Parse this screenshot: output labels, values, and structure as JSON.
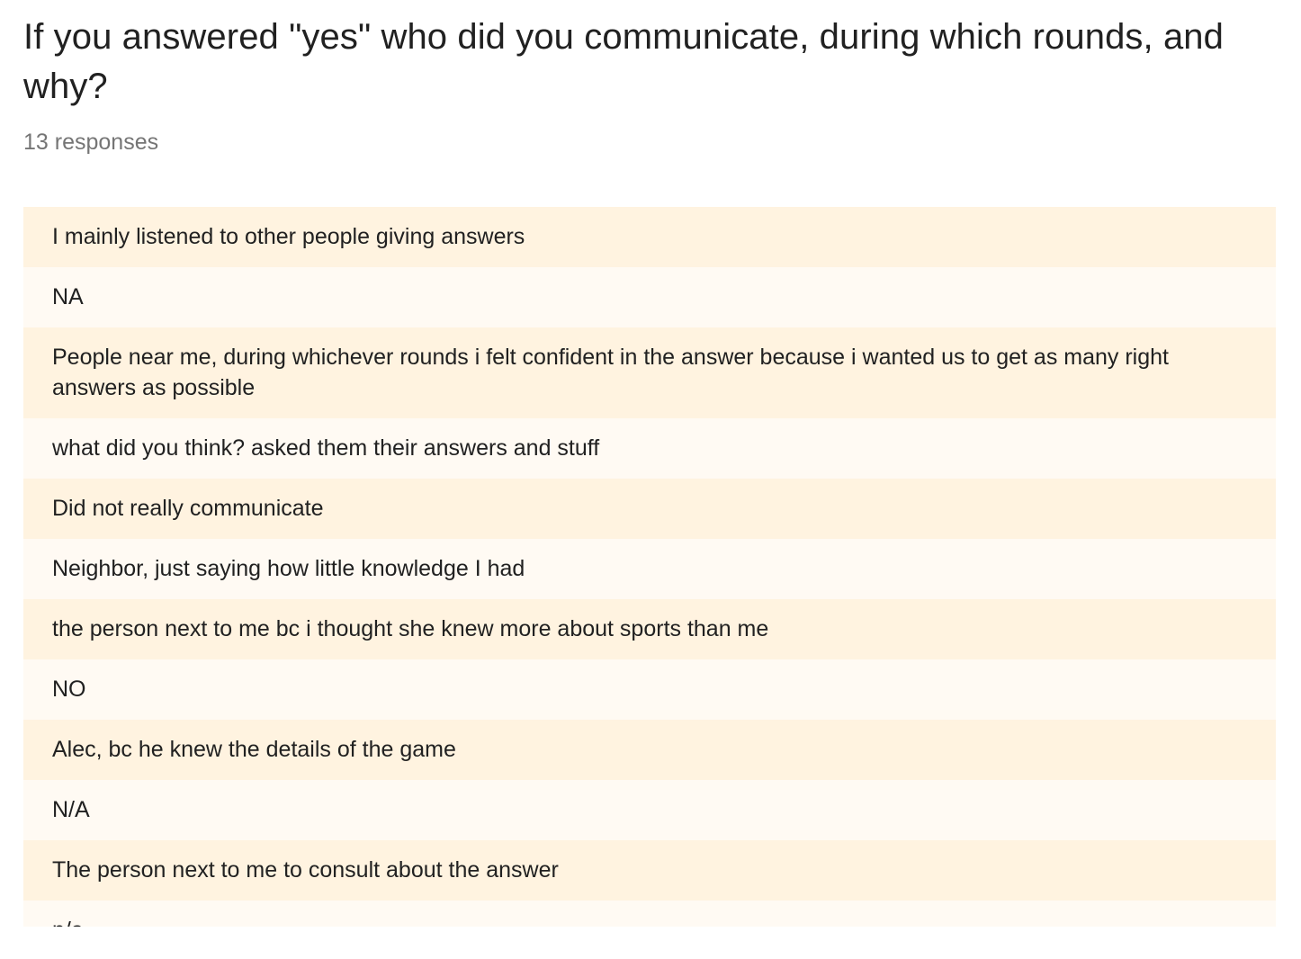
{
  "question": {
    "title": "If you answered \"yes\" who did you communicate, during which rounds, and why?",
    "response_count": "13 responses"
  },
  "responses": [
    "I mainly listened to other people giving answers",
    "NA",
    "People near me, during whichever rounds i felt confident in the answer because i wanted us to get as many right answers as possible",
    "what did you think? asked them their answers and stuff",
    "Did not really communicate",
    "Neighbor, just saying how little knowledge I had",
    "the person next to me bc i thought she knew more about sports than me",
    "NO",
    "Alec, bc he knew the details of the game",
    "N/A",
    "The person next to me to consult about the answer",
    "n/a"
  ],
  "colors": {
    "row_odd": "#fff3e0",
    "row_even": "#fffaf3",
    "title_text": "#212121",
    "count_text": "#757575"
  }
}
